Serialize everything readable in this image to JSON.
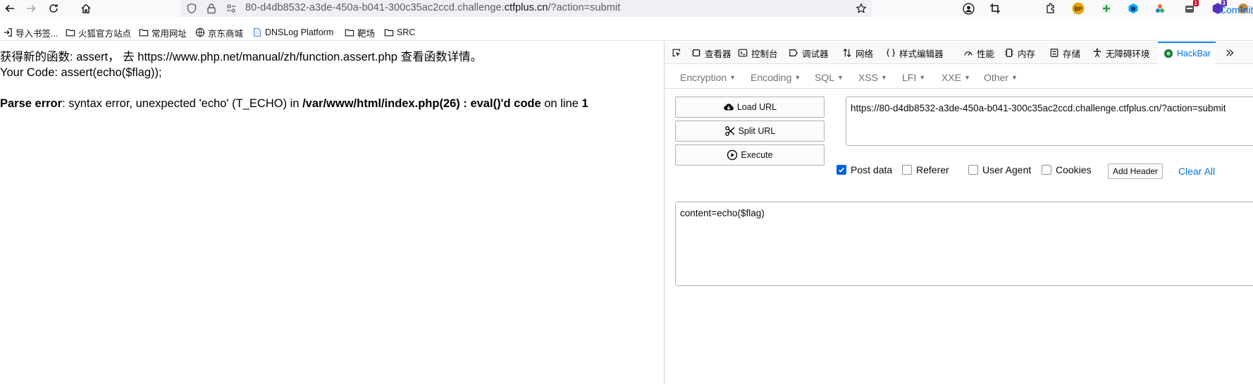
{
  "browser": {
    "url_prefix": "80-d4db8532-a3de-450a-b041-300c35ac2ccd.challenge.",
    "url_domain": "ctfplus.cn",
    "url_suffix": "/?action=submit",
    "extensions": [
      {
        "name": "burp-proxy-icon",
        "label": "BP",
        "color": "#e8a400"
      },
      {
        "name": "plus-extension-icon",
        "label": "",
        "color": "#2ea043"
      },
      {
        "name": "cube-extension-icon",
        "label": "",
        "color": "#00a6ff"
      },
      {
        "name": "gear-extension-icon",
        "label": "",
        "color": "#ef6a1f"
      },
      {
        "name": "badge-extension-icon",
        "label": "1",
        "color": "#d70022"
      },
      {
        "name": "shield-extension-icon",
        "label": "3",
        "color": "#5b2db8"
      }
    ]
  },
  "bookmarks": [
    {
      "label": "导入书签...",
      "icon": "import-icon"
    },
    {
      "label": "火狐官方站点",
      "icon": "folder-icon"
    },
    {
      "label": "常用网址",
      "icon": "folder-icon"
    },
    {
      "label": "京东商城",
      "icon": "globe-icon"
    },
    {
      "label": "DNSLog Platform",
      "icon": "page-icon"
    },
    {
      "label": "靶场",
      "icon": "folder-icon"
    },
    {
      "label": "SRC",
      "icon": "folder-icon"
    }
  ],
  "page": {
    "line1": "获得新的函数: assert， 去 https://www.php.net/manual/zh/function.assert.php 查看函数详情。",
    "line2": "Your Code: assert(echo($flag));",
    "error_label": "Parse error",
    "error_text": ": syntax error, unexpected 'echo' (T_ECHO) in ",
    "error_file": "/var/www/html/index.php(26) : eval()'d code",
    "error_online": " on line ",
    "error_line": "1"
  },
  "devtools": {
    "tabs": [
      {
        "label": "",
        "icon": "pick-element-icon"
      },
      {
        "label": "查看器",
        "icon": "inspector-icon"
      },
      {
        "label": "控制台",
        "icon": "console-icon"
      },
      {
        "label": "调试器",
        "icon": "debugger-icon"
      },
      {
        "label": "网络",
        "icon": "network-icon"
      },
      {
        "label": "样式编辑器",
        "icon": "style-editor-icon"
      },
      {
        "label": "性能",
        "icon": "performance-icon"
      },
      {
        "label": "内存",
        "icon": "memory-icon"
      },
      {
        "label": "存储",
        "icon": "storage-icon"
      },
      {
        "label": "无障碍环境",
        "icon": "accessibility-icon"
      },
      {
        "label": "HackBar",
        "icon": "hackbar-icon",
        "active": true
      }
    ]
  },
  "hackbar": {
    "menu": [
      "Encryption",
      "Encoding",
      "SQL",
      "XSS",
      "LFI",
      "XXE",
      "Other"
    ],
    "commit_label": "Commit",
    "load_url": "Load URL",
    "split_url": "Split URL",
    "execute": "Execute",
    "url_value": "https://80-d4db8532-a3de-450a-b041-300c35ac2ccd.challenge.ctfplus.cn/?action=submit",
    "options": [
      {
        "label": "Post data",
        "checked": true
      },
      {
        "label": "Referer",
        "checked": false
      },
      {
        "label": "User Agent",
        "checked": false
      },
      {
        "label": "Cookies",
        "checked": false
      }
    ],
    "add_header": "Add Header",
    "clear_all": "Clear All",
    "post_body": "content=echo($flag)"
  }
}
